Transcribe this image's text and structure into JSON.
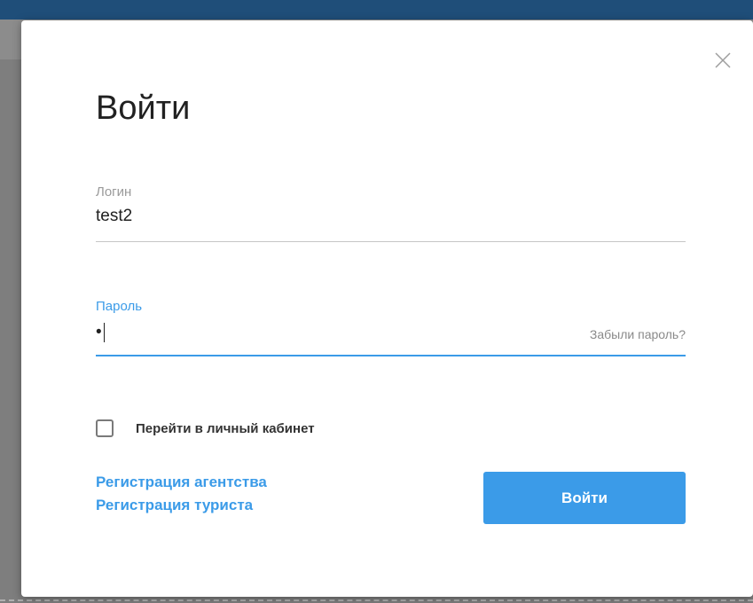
{
  "modal": {
    "title": "Войти",
    "close_icon": "close-icon"
  },
  "login": {
    "label": "Логин",
    "value": "test2"
  },
  "password": {
    "label": "Пароль",
    "masked_value": "•",
    "forgot_link": "Забыли пароль?"
  },
  "remember": {
    "label": "Перейти в личный кабинет",
    "checked": false
  },
  "links": {
    "agency": "Регистрация агентства",
    "tourist": "Регистрация туриста"
  },
  "submit": {
    "label": "Войти"
  },
  "colors": {
    "accent": "#3b9be8",
    "header": "#1f4e79",
    "overlay": "#7e7e7e"
  }
}
